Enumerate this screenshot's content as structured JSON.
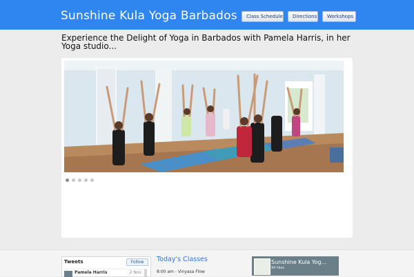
{
  "header": {
    "title": "Sunshine Kula Yoga Barbados",
    "nav": [
      "Class Schedule",
      "Directions",
      "Workshops"
    ]
  },
  "headline": "Experience the Delight of Yoga in Barbados with Pamela Harris, in her Yoga studio...",
  "slider": {
    "dots": 5,
    "active_dot": 1
  },
  "tweets": {
    "title": "Tweets",
    "follow_label": "Follow",
    "items": [
      {
        "author": "Pamela Harris",
        "date": "2 Nov"
      }
    ]
  },
  "classes": {
    "title": "Today's Classes",
    "items": [
      "8:00 am - Vinyasa Flow"
    ]
  },
  "facebook": {
    "page_name": "Sunshine Kula Yog...",
    "likes": "94 likes"
  },
  "colors": {
    "header_bg": "#2f86f0",
    "page_bg": "#ececec",
    "accent": "#2f7ad8"
  }
}
